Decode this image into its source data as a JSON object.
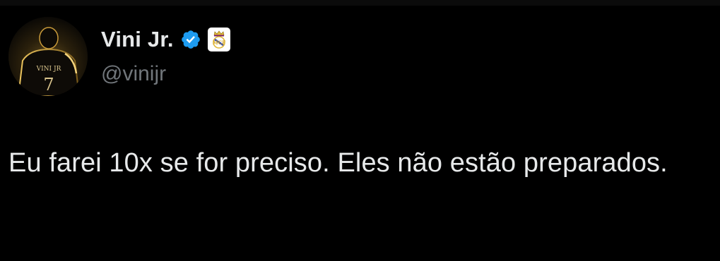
{
  "author": {
    "display_name": "Vini Jr.",
    "handle": "@vinijr",
    "verified": true,
    "verified_icon": "verified-badge-icon",
    "affiliate_icon": "real-madrid-crest-icon",
    "avatar_text": "VINI JR",
    "avatar_number": "7"
  },
  "tweet": {
    "text": "Eu farei 10x se for preciso. Eles não estão preparados."
  },
  "colors": {
    "background": "#000000",
    "primary_text": "#e7e9ea",
    "secondary_text": "#71767b",
    "verified_blue": "#1d9bf0"
  }
}
